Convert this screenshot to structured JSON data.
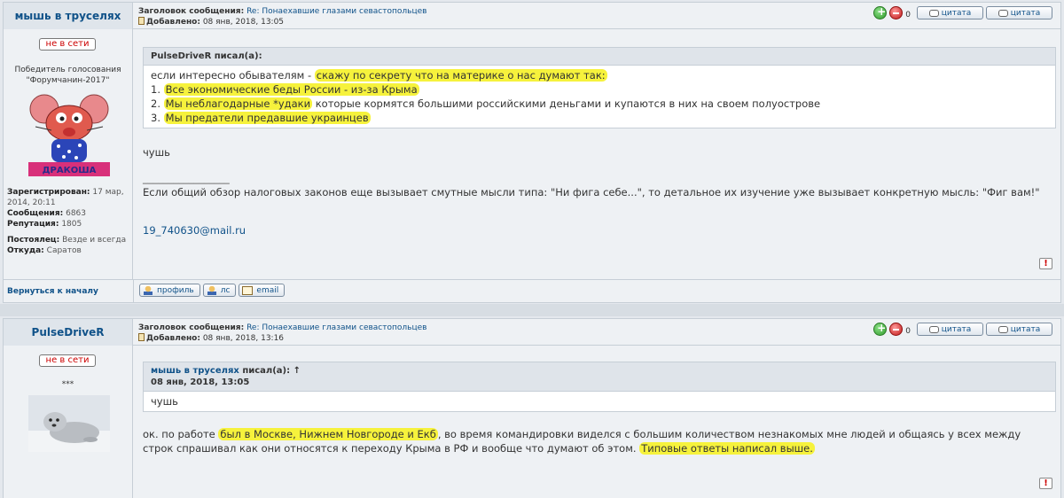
{
  "posts": [
    {
      "author": "мышь в труселях",
      "subject_label": "Заголовок сообщения:",
      "subject": "Re: Понаехавшие глазами севастопольцев",
      "added_label": "Добавлено:",
      "added": "08 янв, 2018, 13:05",
      "vote_count": "0",
      "quote_label": "цитата",
      "quote_label2": "цитата",
      "status": "не в сети",
      "rank_line1": "Победитель голосования",
      "rank_line2": "\"Форумчанин-2017\"",
      "avatar_caption": "ДРАКОША",
      "registered_label": "Зарегистрирован:",
      "registered": "17 мар, 2014, 20:11",
      "messages_label": "Сообщения:",
      "messages": "6863",
      "reputation_label": "Репутация:",
      "reputation": "1805",
      "resident_label": "Постоялец:",
      "resident": "Везде и всегда",
      "from_label": "Откуда:",
      "from": "Саратов",
      "quote": {
        "author": "PulseDriveR",
        "wrote": "писал(а):",
        "intro": "если интересно обывателям - ",
        "intro_hl": "скажу по секрету что на материке о нас думают так:",
        "item1_num": "1. ",
        "item1": "Все экономические беды России - из-за Крыма",
        "item2_num": "2. ",
        "item2_hl": "Мы неблагодарные *удаки",
        "item2_rest": " которые кормятся большими российскими деньгами и купаются в них на своем полуострове",
        "item3_num": "3. ",
        "item3": "Мы предатели предавшие украинцев"
      },
      "text": "чушь",
      "sig_line": "_________________",
      "signature": "Если общий обзор налоговых законов еще вызывает смутные мысли типа: \"Ни фига себе...\", то детальное их изучение уже вызывает конкретную мысль: \"Фиг вам!\"",
      "email_text": "19_740630@mail.ru"
    },
    {
      "author": "PulseDriveR",
      "subject_label": "Заголовок сообщения:",
      "subject": "Re: Понаехавшие глазами севастопольцев",
      "added_label": "Добавлено:",
      "added": "08 янв, 2018, 13:16",
      "vote_count": "0",
      "quote_label": "цитата",
      "quote_label2": "цитата",
      "status": "не в сети",
      "rank": "***",
      "quote": {
        "author": "мышь в труселях",
        "wrote": " писал(а): ↑",
        "date": "08 янв, 2018, 13:05",
        "text": "чушь"
      },
      "text_a": "ок. по работе ",
      "text_hl1": "был в Москве, Нижнем Новгороде и Екб",
      "text_b": ", во время командировки виделся с большим количеством незнакомых мне людей и общаясь у всех между строк спрашивал как они относятся к переходу Крыма в РФ и вообще что думают об этом. ",
      "text_hl2": "Типовые ответы написал выше."
    }
  ],
  "bottom_bar": {
    "back_to_top": "Вернуться к началу",
    "profile": "профиль",
    "pm": "лс",
    "email": "email"
  },
  "report_symbol": "!",
  "colors": {
    "link": "#105289",
    "highlight": "#f6f23c",
    "offline": "#cc0000"
  }
}
